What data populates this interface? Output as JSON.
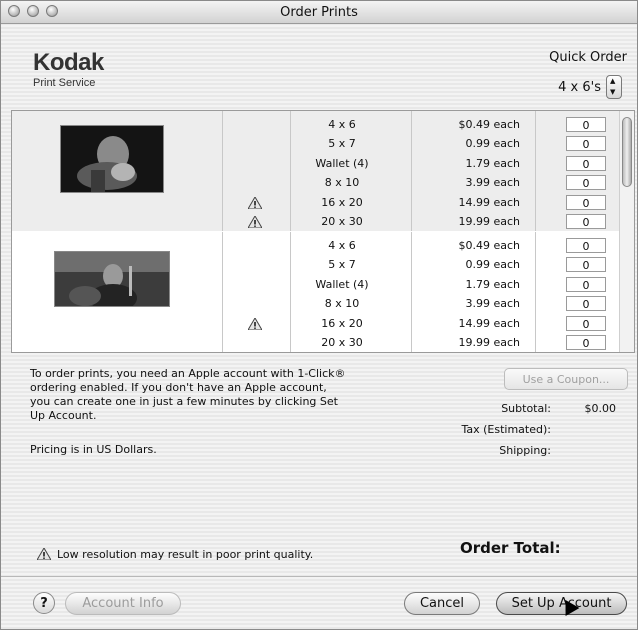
{
  "window": {
    "title": "Order Prints"
  },
  "brand": {
    "name": "Kodak",
    "subtitle": "Print Service"
  },
  "quick_order": {
    "label": "Quick Order",
    "value": "4 x 6's"
  },
  "groups": [
    {
      "rows": [
        {
          "size": "4 x 6",
          "price": "$0.49 each",
          "qty": "0",
          "warn": false
        },
        {
          "size": "5 x 7",
          "price": "0.99 each",
          "qty": "0",
          "warn": false
        },
        {
          "size": "Wallet (4)",
          "price": "1.79 each",
          "qty": "0",
          "warn": false
        },
        {
          "size": "8 x 10",
          "price": "3.99 each",
          "qty": "0",
          "warn": false
        },
        {
          "size": "16 x 20",
          "price": "14.99 each",
          "qty": "0",
          "warn": true
        },
        {
          "size": "20 x 30",
          "price": "19.99 each",
          "qty": "0",
          "warn": true
        }
      ]
    },
    {
      "rows": [
        {
          "size": "4 x 6",
          "price": "$0.49 each",
          "qty": "0",
          "warn": false
        },
        {
          "size": "5 x 7",
          "price": "0.99 each",
          "qty": "0",
          "warn": false
        },
        {
          "size": "Wallet (4)",
          "price": "1.79 each",
          "qty": "0",
          "warn": false
        },
        {
          "size": "8 x 10",
          "price": "3.99 each",
          "qty": "0",
          "warn": false
        },
        {
          "size": "16 x 20",
          "price": "14.99 each",
          "qty": "0",
          "warn": true
        },
        {
          "size": "20 x 30",
          "price": "19.99 each",
          "qty": "0",
          "warn": false
        }
      ]
    }
  ],
  "info": {
    "account_text": "To order prints, you need an Apple account with 1-Click® ordering enabled. If you don't have an Apple account, you can create one in just a few minutes by clicking Set Up Account.",
    "pricing_note": "Pricing is in US Dollars.",
    "low_res_warning": "Low resolution may result in poor print quality."
  },
  "summary": {
    "coupon_label": "Use a Coupon...",
    "subtotal_label": "Subtotal:",
    "subtotal_value": "$0.00",
    "tax_label": "Tax (Estimated):",
    "shipping_label": "Shipping:",
    "total_label": "Order Total:"
  },
  "footer": {
    "help_label": "?",
    "account_info_label": "Account Info",
    "cancel_label": "Cancel",
    "setup_label": "Set Up Account"
  }
}
